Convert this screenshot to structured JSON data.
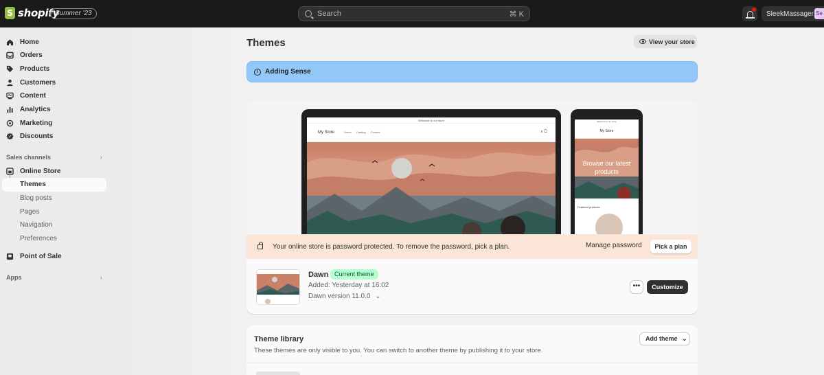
{
  "topbar": {
    "brand": "shopify",
    "edition": "Summer '23",
    "search_placeholder": "Search",
    "search_shortcut": "⌘ K",
    "store_name": "SleekMassager",
    "store_initials": "Se"
  },
  "sidebar": {
    "main_items": [
      {
        "label": "Home",
        "icon": "home-icon"
      },
      {
        "label": "Orders",
        "icon": "orders-icon"
      },
      {
        "label": "Products",
        "icon": "tag-icon"
      },
      {
        "label": "Customers",
        "icon": "person-icon"
      },
      {
        "label": "Content",
        "icon": "content-icon"
      },
      {
        "label": "Analytics",
        "icon": "bar-chart-icon"
      },
      {
        "label": "Marketing",
        "icon": "target-icon"
      },
      {
        "label": "Discounts",
        "icon": "discount-icon"
      }
    ],
    "sales_channels_label": "Sales channels",
    "online_store": "Online Store",
    "sub_items": [
      "Themes",
      "Blog posts",
      "Pages",
      "Navigation",
      "Preferences"
    ],
    "point_of_sale": "Point of Sale",
    "apps_label": "Apps"
  },
  "main": {
    "title": "Themes",
    "view_store": "View your store",
    "banner": "Adding Sense",
    "preview": {
      "announcement": "Welcome to our store",
      "store_name": "My Store",
      "nav_links": "Home Catalog Contact",
      "phone_hero": "Browse our latest products",
      "phone_featured": "Featured products"
    },
    "password_notice": "Your online store is password protected. To remove the password, pick a plan.",
    "manage_password": "Manage password",
    "pick_plan": "Pick a plan",
    "current_theme": {
      "name": "Dawn",
      "badge": "Current theme",
      "added": "Added: Yesterday at 16:02",
      "version": "Dawn version 11.0.0",
      "more": "•••",
      "customize": "Customize"
    },
    "library": {
      "title": "Theme library",
      "description": "These themes are only visible to you. You can switch to another theme by publishing it to your store.",
      "add_theme": "Add theme"
    }
  },
  "colors": {
    "topbar": "#1a1a1a",
    "banner": "#91c8f8",
    "password_bar": "#fbe5d6",
    "badge": "#b4fed2",
    "primary_button": "#303030"
  }
}
